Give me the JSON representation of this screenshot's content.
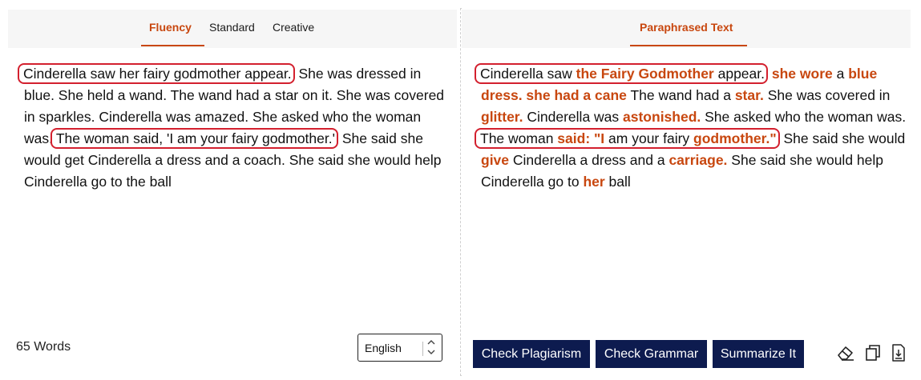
{
  "left_panel": {
    "tabs": [
      {
        "label": "Fluency",
        "active": true
      },
      {
        "label": "Standard",
        "active": false
      },
      {
        "label": "Creative",
        "active": false
      }
    ],
    "segments": [
      {
        "text": "Cinderella saw her fairy godmother appear.",
        "highlight": true
      },
      {
        "text": " She was dressed in blue. She held a wand. The wand had a star on it. She was covered in sparkles. Cinderella was amazed. She asked who the woman was. "
      },
      {
        "text": "The woman said, 'I am your fairy godmother.'",
        "highlight": true
      },
      {
        "text": " She said she would get Cinderella a dress and a coach. She said she would help Cinderella go to the ball"
      }
    ],
    "word_count": "65 Words",
    "language": "English"
  },
  "right_panel": {
    "tab_label": "Paraphrased Text",
    "segments": [
      {
        "text": "Cinderella saw ",
        "highlight_start": true
      },
      {
        "text": "the Fairy Godmother",
        "changed": true
      },
      {
        "text": " appear.",
        "highlight_end": true
      },
      {
        "text": " "
      },
      {
        "text": "she wore",
        "changed": true
      },
      {
        "text": " a "
      },
      {
        "text": "blue dress. she had a cane",
        "changed": true
      },
      {
        "text": " The wand had a "
      },
      {
        "text": "star.",
        "changed": true
      },
      {
        "text": " She was covered in "
      },
      {
        "text": "glitter.",
        "changed": true
      },
      {
        "text": " Cinderella was "
      },
      {
        "text": "astonished.",
        "changed": true
      },
      {
        "text": " She asked who the woman was. "
      },
      {
        "text": "The woman ",
        "highlight_start": true
      },
      {
        "text": "said: \"I",
        "changed": true
      },
      {
        "text": " am your fairy "
      },
      {
        "text": "godmother.\"",
        "changed": true,
        "highlight_end": true
      },
      {
        "text": " She said she would "
      },
      {
        "text": "give",
        "changed": true
      },
      {
        "text": " Cinderella a dress and a "
      },
      {
        "text": "carriage.",
        "changed": true
      },
      {
        "text": " She said she would help Cinderella go to "
      },
      {
        "text": "her",
        "changed": true
      },
      {
        "text": " ball"
      }
    ],
    "buttons": {
      "check_plagiarism": "Check Plagiarism",
      "check_grammar": "Check Grammar",
      "summarize": "Summarize It"
    },
    "icons": [
      "eraser-icon",
      "copy-icon",
      "download-icon"
    ]
  },
  "colors": {
    "accent": "#c8470f",
    "highlight_border": "#d3202e",
    "button_bg": "#0d1b4f"
  }
}
